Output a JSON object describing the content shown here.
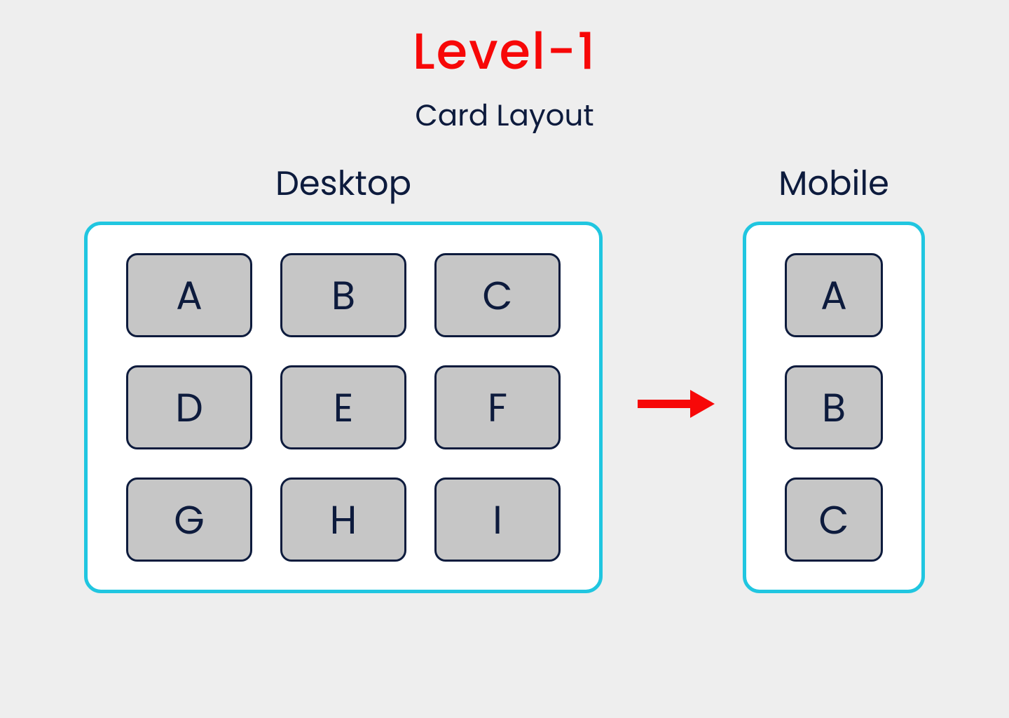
{
  "header": {
    "title": "Level-1",
    "subtitle": "Card Layout"
  },
  "desktop": {
    "label": "Desktop",
    "cards": [
      "A",
      "B",
      "C",
      "D",
      "E",
      "F",
      "G",
      "H",
      "I"
    ]
  },
  "mobile": {
    "label": "Mobile",
    "cards": [
      "A",
      "B",
      "C"
    ]
  },
  "colors": {
    "accent_red": "#f70808",
    "frame_border": "#20c6e0",
    "card_bg": "#c6c6c6",
    "text_dark": "#0d1b3d"
  }
}
